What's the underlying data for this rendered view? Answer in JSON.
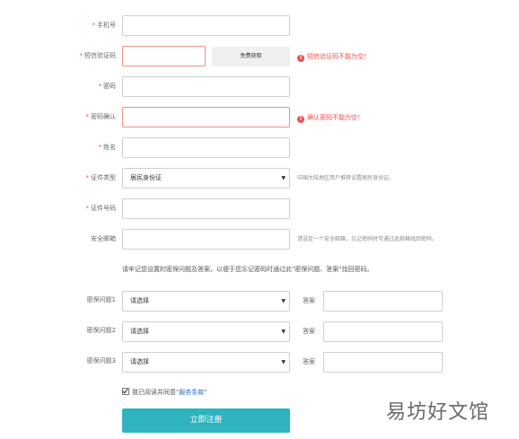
{
  "form": {
    "phone": {
      "label": "手机号",
      "required": true
    },
    "sms_code": {
      "label": "短信验证码",
      "required": true,
      "button": "免费获取",
      "error": "短信验证码不能为空！"
    },
    "password": {
      "label": "密码",
      "required": true
    },
    "password_confirm": {
      "label": "密码确认",
      "required": true,
      "error": "确认密码不能为空！"
    },
    "name": {
      "label": "姓名",
      "required": true
    },
    "id_type": {
      "label": "证件类型",
      "required": true,
      "selected": "居民身份证",
      "hint": "中国大陆地区用户推荐设置居民身份证。"
    },
    "id_number": {
      "label": "证件号码",
      "required": true
    },
    "email": {
      "label": "安全邮箱",
      "required": false,
      "hint": "请设定一个安全邮箱，忘记密码时可通过此邮箱找回密码。"
    },
    "security_note": "请牢记您设置的密保问题及答案，以便于您忘记密码时通过此\"密保问题、答案\"找回密码。",
    "questions": [
      {
        "label": "密保问题1",
        "selected": "请选择",
        "answer_label": "答案"
      },
      {
        "label": "密保问题2",
        "selected": "请选择",
        "answer_label": "答案"
      },
      {
        "label": "密保问题3",
        "selected": "请选择",
        "answer_label": "答案"
      }
    ],
    "agree": {
      "text": "我已阅读并同意",
      "terms": "\"服务条款\""
    },
    "submit": "立即注册"
  },
  "error_icon": "!",
  "required_mark": "*",
  "watermark": "易坊好文馆",
  "colors": {
    "error": "#e8504f",
    "primary": "#2fb3be",
    "link": "#2a6fbd"
  }
}
